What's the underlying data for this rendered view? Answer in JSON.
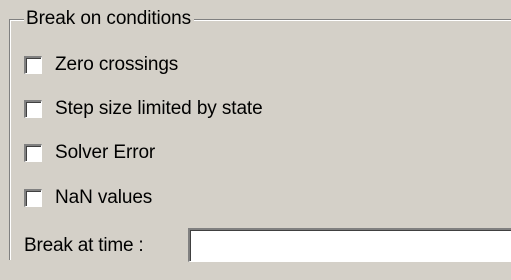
{
  "group": {
    "title": "Break on conditions"
  },
  "options": [
    {
      "label": "Zero crossings",
      "checked": false
    },
    {
      "label": "Step size limited by state",
      "checked": false
    },
    {
      "label": "Solver Error",
      "checked": false
    },
    {
      "label": "NaN values",
      "checked": false
    }
  ],
  "break_at_time": {
    "label": "Break at time :",
    "value": "",
    "placeholder": ""
  },
  "colors": {
    "background": "#d4d0c8",
    "field": "#ffffff",
    "shadow": "#808080",
    "highlight": "#ffffff"
  }
}
